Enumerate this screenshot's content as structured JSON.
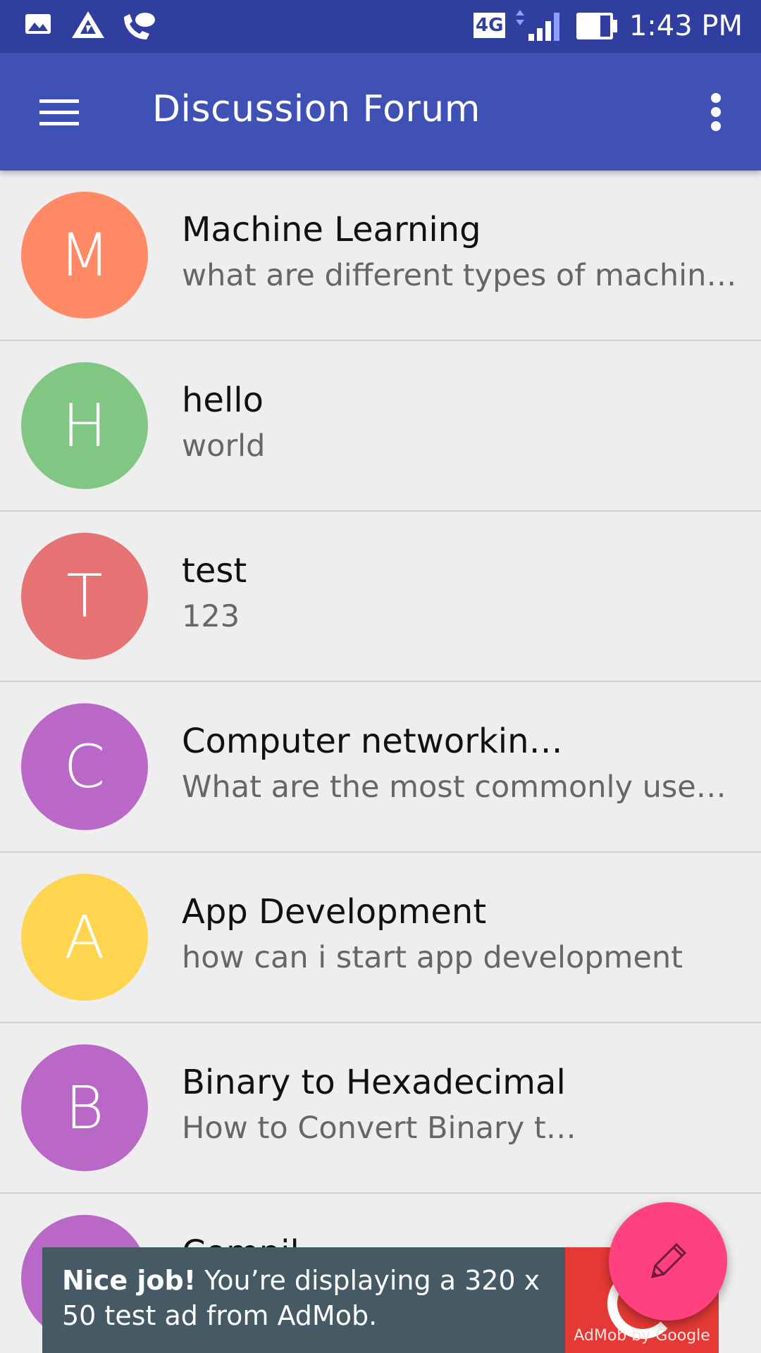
{
  "status_bar": {
    "time": "1:43 PM",
    "network_label": "4G",
    "icons": [
      "image-icon",
      "drive-icon",
      "call-icon",
      "signal-icon",
      "battery-icon"
    ]
  },
  "app_bar": {
    "title": "Discussion Forum",
    "color": "#3f51b5"
  },
  "topics": [
    {
      "initial": "M",
      "title": "Machine Learning",
      "subtitle": "what are different types of machine learning",
      "color": "#ff8a65"
    },
    {
      "initial": "H",
      "title": "hello",
      "subtitle": "world",
      "color": "#81c784"
    },
    {
      "initial": "T",
      "title": "test",
      "subtitle": "123",
      "color": "#e57373"
    },
    {
      "initial": "C",
      "title": "Computer networking protocols",
      "subtitle": "What are the most commonly used protocols",
      "color": "#ba68c8"
    },
    {
      "initial": "A",
      "title": "App Development",
      "subtitle": "how can i start app development",
      "color": "#ffd54f"
    },
    {
      "initial": "B",
      "title": "Binary to Hexadecimal",
      "subtitle": "How to Convert Binary to Hexadecimal",
      "color": "#ba68c8"
    },
    {
      "initial": "C",
      "title": "Compil",
      "subtitle": "",
      "color": "#ba68c8"
    }
  ],
  "ad": {
    "bold": "Nice job!",
    "text": " You’re displaying a 320 x 50 test ad from AdMob.",
    "brand": "AdMob by Google"
  },
  "fab": {
    "icon": "pencil-icon",
    "color": "#ff4081"
  }
}
